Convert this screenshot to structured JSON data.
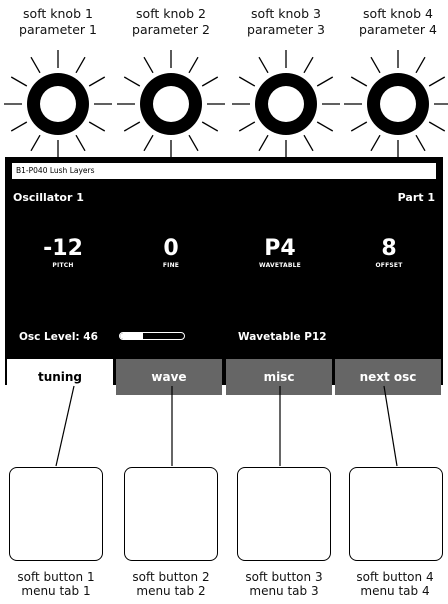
{
  "knobs": [
    {
      "line1": "soft knob 1",
      "line2": "parameter 1"
    },
    {
      "line1": "soft knob 2",
      "line2": "parameter 2"
    },
    {
      "line1": "soft knob 3",
      "line2": "parameter 3"
    },
    {
      "line1": "soft knob 4",
      "line2": "parameter 4"
    }
  ],
  "screen": {
    "patch_name": "B1-P040 Lush Layers",
    "section_title": "Oscillator 1",
    "part": "Part 1",
    "params": [
      {
        "value": "-12",
        "label": "PITCH"
      },
      {
        "value": "0",
        "label": "FINE"
      },
      {
        "value": "P4",
        "label": "WAVETABLE"
      },
      {
        "value": "8",
        "label": "OFFSET"
      }
    ],
    "osc_level_text": "Osc Level: 46",
    "osc_level_fraction": 0.36,
    "wavetable_text": "Wavetable P12",
    "tabs": [
      {
        "label": "tuning",
        "active": true
      },
      {
        "label": "wave",
        "active": false
      },
      {
        "label": "misc",
        "active": false
      },
      {
        "label": "next osc",
        "active": false
      }
    ]
  },
  "buttons": [
    {
      "line1": "soft button 1",
      "line2": "menu tab 1"
    },
    {
      "line1": "soft button 2",
      "line2": "menu tab 2"
    },
    {
      "line1": "soft button 3",
      "line2": "menu tab 3"
    },
    {
      "line1": "soft button 4",
      "line2": "menu tab 4"
    }
  ],
  "colors": {
    "screen_bg": "#000000",
    "tab_active_bg": "#ffffff",
    "tab_inactive_bg": "#666666"
  }
}
